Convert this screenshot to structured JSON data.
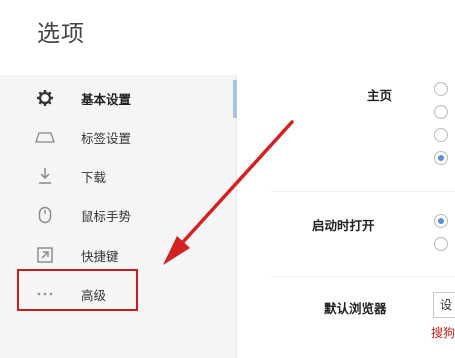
{
  "page": {
    "title": "选项"
  },
  "sidebar": {
    "items": [
      {
        "label": "基本设置",
        "icon": "gear-icon",
        "active": true
      },
      {
        "label": "标签设置",
        "icon": "tab-icon"
      },
      {
        "label": "下载",
        "icon": "download-icon"
      },
      {
        "label": "鼠标手势",
        "icon": "mouse-icon"
      },
      {
        "label": "快捷键",
        "icon": "shortcut-icon"
      },
      {
        "label": "高级",
        "icon": "more-dots-icon"
      }
    ]
  },
  "settings": {
    "homepage": {
      "label": "主页",
      "options_checked": [
        false,
        false,
        false,
        true
      ]
    },
    "startup": {
      "label": "启动时打开",
      "options_checked": [
        true,
        false
      ]
    },
    "default_browser": {
      "label": "默认浏览器",
      "button_text": "设",
      "note": "搜狗"
    }
  },
  "annotation": {
    "highlight_color": "#cc1b1b",
    "arrow_color": "#d42020"
  }
}
